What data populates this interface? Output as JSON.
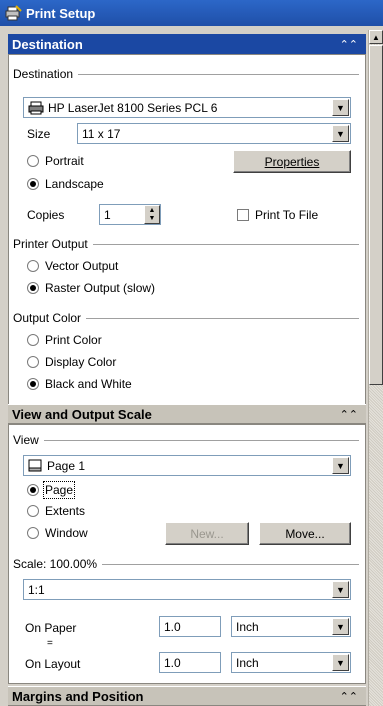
{
  "window": {
    "title": "Print Setup"
  },
  "destination": {
    "section_title": "Destination",
    "group_label": "Destination",
    "printer": "HP LaserJet 8100 Series PCL 6",
    "size_label": "Size",
    "size_value": "11 x 17",
    "orientation": {
      "portrait_label": "Portrait",
      "landscape_label": "Landscape",
      "selected": "landscape"
    },
    "properties_button": "Properties",
    "copies_label": "Copies",
    "copies_value": "1",
    "print_to_file_label": "Print To File"
  },
  "printer_output": {
    "group_label": "Printer Output",
    "vector_label": "Vector Output",
    "raster_label": "Raster Output (slow)",
    "selected": "raster"
  },
  "output_color": {
    "group_label": "Output Color",
    "print_color_label": "Print Color",
    "display_color_label": "Display Color",
    "bw_label": "Black and White",
    "selected": "bw"
  },
  "view_scale": {
    "section_title": "View and Output Scale",
    "view_group_label": "View",
    "view_value": "Page 1",
    "page_label": "Page",
    "extents_label": "Extents",
    "window_label": "Window",
    "selected": "page",
    "new_button": "New...",
    "move_button": "Move...",
    "scale_label": "Scale: 100.00%",
    "scale_value": "1:1",
    "on_paper_label": "On Paper",
    "on_paper_value": "1.0",
    "on_paper_unit": "Inch",
    "equals": "=",
    "on_layout_label": "On Layout",
    "on_layout_value": "1.0",
    "on_layout_unit": "Inch"
  },
  "margins": {
    "section_title": "Margins and Position"
  },
  "icons": {
    "app": "printer-wrench-icon",
    "printer": "printer-icon",
    "page": "page-icon",
    "collapse": "double-chevron-up-icon",
    "dropdown": "chevron-down-icon"
  },
  "colors": {
    "active_header": "#1b48a3",
    "title_bar": "#2c67c8"
  }
}
